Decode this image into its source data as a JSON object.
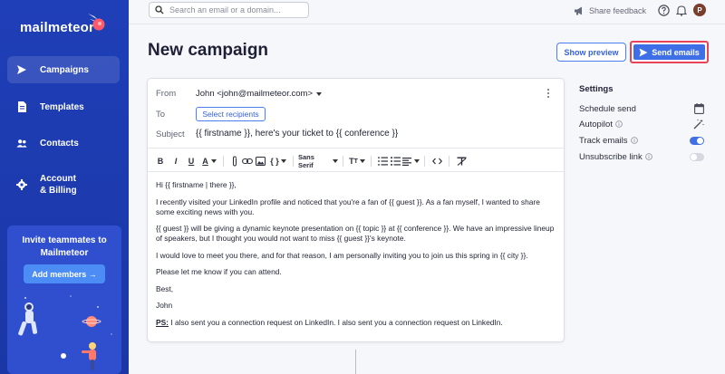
{
  "app": {
    "brand": "mailmeteor"
  },
  "colors": {
    "sidebar": "#1f3fb8",
    "accent": "#3f6fe6",
    "highlight": "#e8435a",
    "toggle_on": "#3f6fe6",
    "toggle_off": "#d5d8e0"
  },
  "sidebar": {
    "items": [
      {
        "label": "Campaigns",
        "icon": "paper-plane-icon",
        "active": true
      },
      {
        "label": "Templates",
        "icon": "document-icon",
        "active": false
      },
      {
        "label": "Contacts",
        "icon": "users-icon",
        "active": false
      },
      {
        "label": "Account",
        "label2": "& Billing",
        "icon": "gear-icon",
        "active": false
      }
    ],
    "invite": {
      "title1": "Invite teammates to",
      "title2": "Mailmeteor",
      "button": "Add members →"
    }
  },
  "topbar": {
    "search_placeholder": "Search an email or a domain...",
    "share_feedback": "Share feedback",
    "avatar_initial": "P"
  },
  "page": {
    "title": "New campaign",
    "preview_button": "Show preview",
    "send_button": "Send emails"
  },
  "compose": {
    "from_label": "From",
    "from_value": "John <john@mailmeteor.com>",
    "to_label": "To",
    "to_button": "Select recipients",
    "subject_label": "Subject",
    "subject_value": "{{ firstname }}, here's your ticket to {{ conference }}",
    "toolbar": {
      "font": "Sans Serif"
    },
    "body": {
      "greeting": "Hi {{ firstname | there }},",
      "p1": "I recently visited your LinkedIn profile and noticed that you're a fan of {{ guest }}. As a fan myself, I wanted to share some exciting news with you.",
      "p2": "{{ guest }} will be giving a dynamic keynote presentation on {{ topic }} at {{ conference }}. We have an impressive lineup of speakers, but I thought you would not want to miss {{ guest }}'s keynote.",
      "p3": "I would love to meet you there, and for that reason, I am personally inviting you to join us this spring in {{ city }}.",
      "p4": "Please let me know if you can attend.",
      "signoff": "Best,",
      "name": "John",
      "ps_label": "PS:",
      "ps_text": " I also sent you a connection request on LinkedIn. I also sent you a connection request on LinkedIn."
    }
  },
  "settings": {
    "title": "Settings",
    "items": [
      {
        "label": "Schedule send",
        "control": "calendar-icon"
      },
      {
        "label": "Autopilot",
        "control": "magic-wand-icon"
      },
      {
        "label": "Track emails",
        "control": "toggle",
        "on": true
      },
      {
        "label": "Unsubscribe link",
        "control": "toggle",
        "on": false
      }
    ]
  }
}
